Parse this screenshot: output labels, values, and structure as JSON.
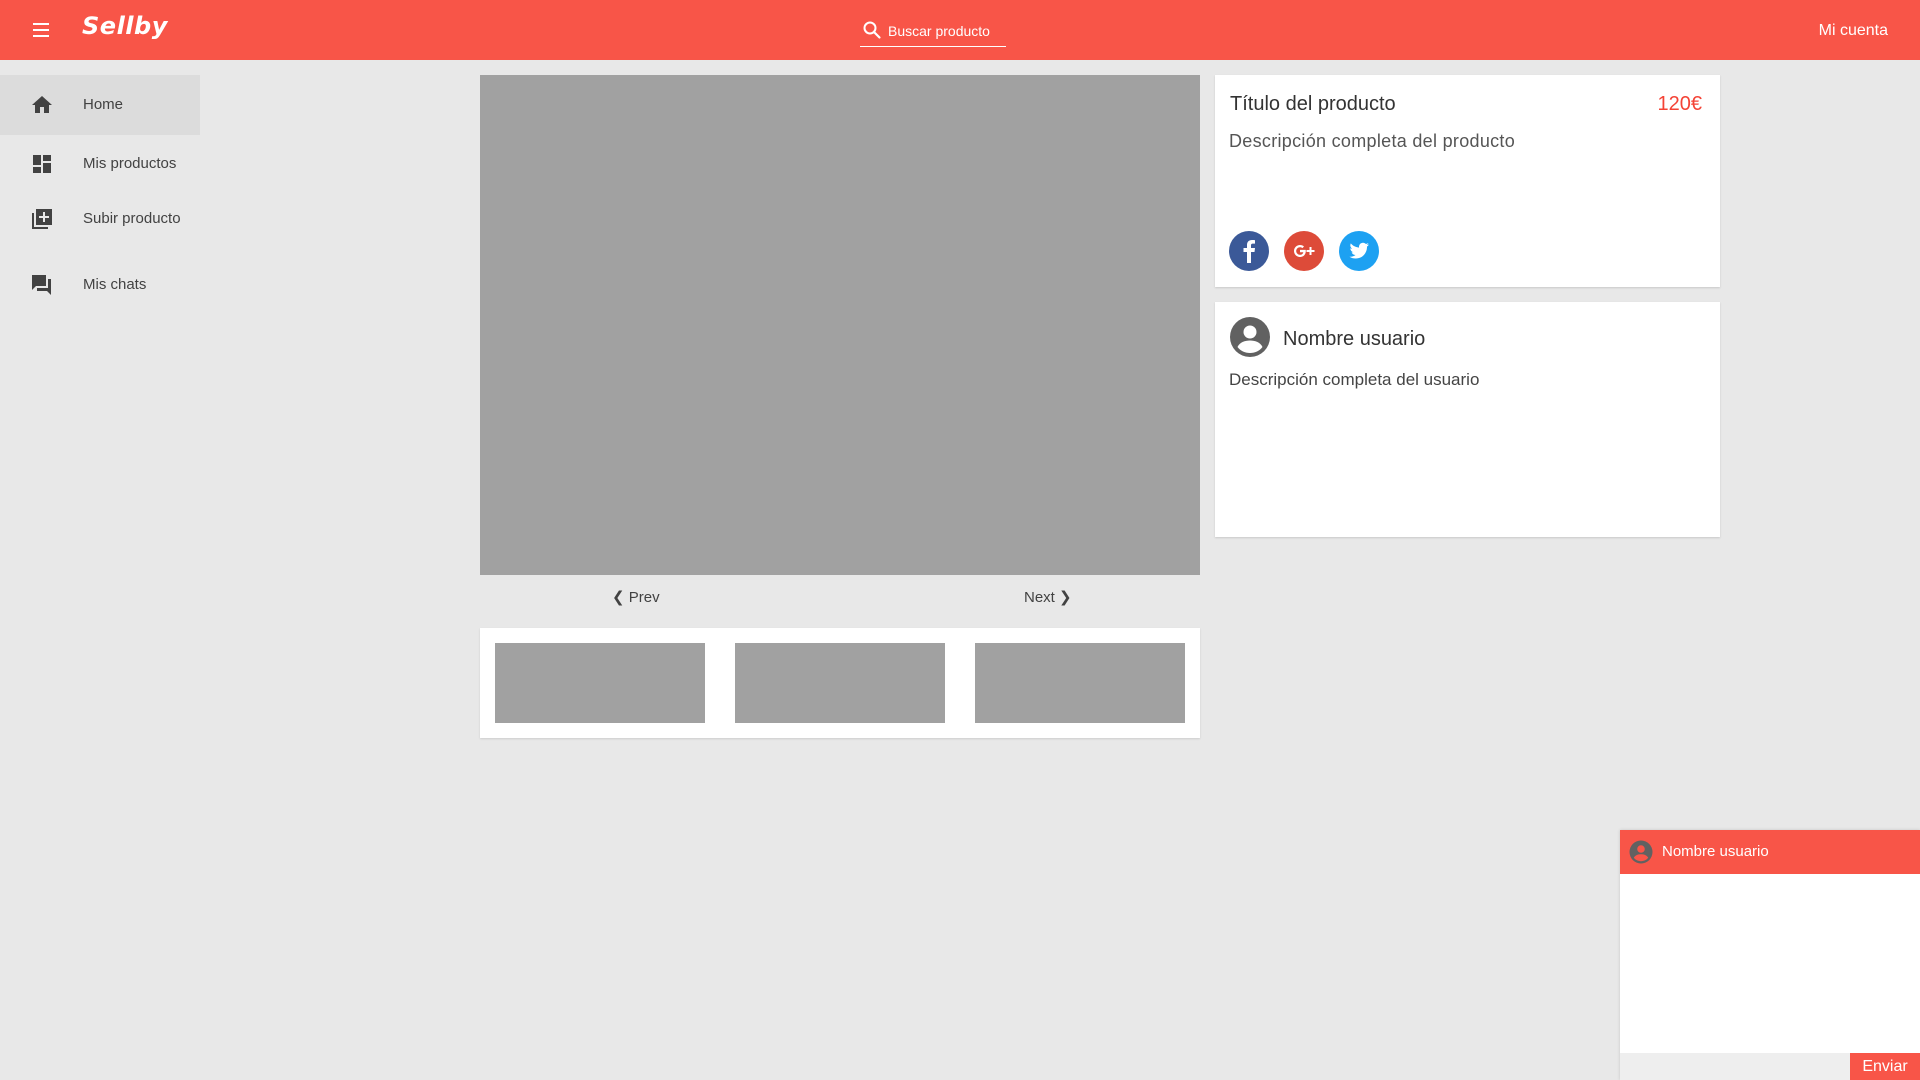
{
  "app": {
    "name": "Sellby"
  },
  "header": {
    "menu_icon": "menu-icon",
    "search": {
      "icon": "search-icon",
      "placeholder": "Buscar producto",
      "value": ""
    },
    "account_label": "Mi cuenta"
  },
  "sidebar": {
    "items": [
      {
        "label": "Home",
        "icon": "home-icon",
        "active": true
      },
      {
        "label": "Mis productos",
        "icon": "dashboard-icon",
        "active": false
      },
      {
        "label": "Subir producto",
        "icon": "add-box-icon",
        "active": false
      },
      {
        "label": "Mis chats",
        "icon": "chat-icon",
        "active": false
      }
    ]
  },
  "gallery": {
    "prev_label": "❮ Prev",
    "next_label": "Next ❯",
    "thumbnail_count": 3
  },
  "product": {
    "title": "Título del producto",
    "price": "120€",
    "description": "Descripción completa del producto",
    "share": [
      {
        "icon": "facebook-icon",
        "color": "#3b5998"
      },
      {
        "icon": "google-plus-icon",
        "color": "#dd4b39"
      },
      {
        "icon": "twitter-icon",
        "color": "#1da1f2"
      }
    ]
  },
  "user": {
    "name": "Nombre usuario",
    "description": "Descripción completa del usuario",
    "avatar_icon": "account-circle-icon"
  },
  "chat": {
    "user_name": "Nombre usuario",
    "send_label": "Enviar",
    "input_value": ""
  },
  "colors": {
    "accent": "#f85548",
    "price": "#f44336",
    "background": "#e8e8e8",
    "placeholder_image": "#a1a1a1"
  }
}
